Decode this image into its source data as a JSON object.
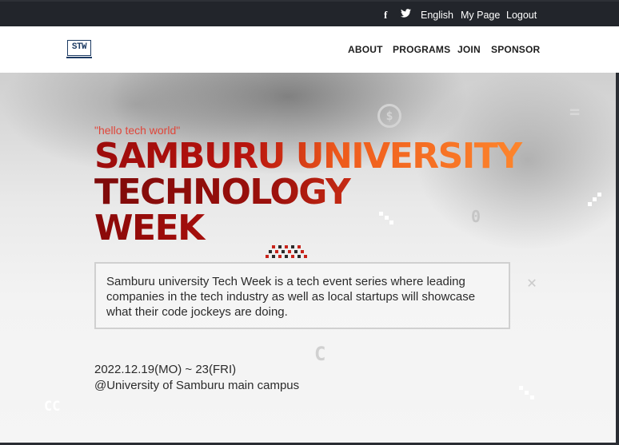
{
  "topbar": {
    "facebook_glyph": "f",
    "language_label": "English",
    "mypage_label": "My Page",
    "logout_label": "Logout"
  },
  "header": {
    "logo_text": "STW",
    "nav": {
      "about": "ABOUT",
      "programs": "PROGRAMS",
      "join": "JOIN",
      "sponsor": "SPONSOR"
    }
  },
  "hero": {
    "greeting": "\"hello tech world\"",
    "title_lines": [
      "SAMBURU UNIVERSITY",
      "TECHNOLOGY",
      "WEEK"
    ],
    "description": "Samburu university Tech Week is a tech event series where leading companies in the tech industry as well as local startups will showcase what their code jockeys are doing.",
    "date": "2022.12.19(MO) ~ 23(FRI)",
    "location": "@University of Samburu main campus"
  },
  "colors": {
    "topbar_bg": "#22252b",
    "title_dark": "#9c0b0b",
    "title_orange": "#ff8a2e",
    "greeting": "#e0463a"
  },
  "icons": [
    "facebook-icon",
    "twitter-icon",
    "logo"
  ]
}
